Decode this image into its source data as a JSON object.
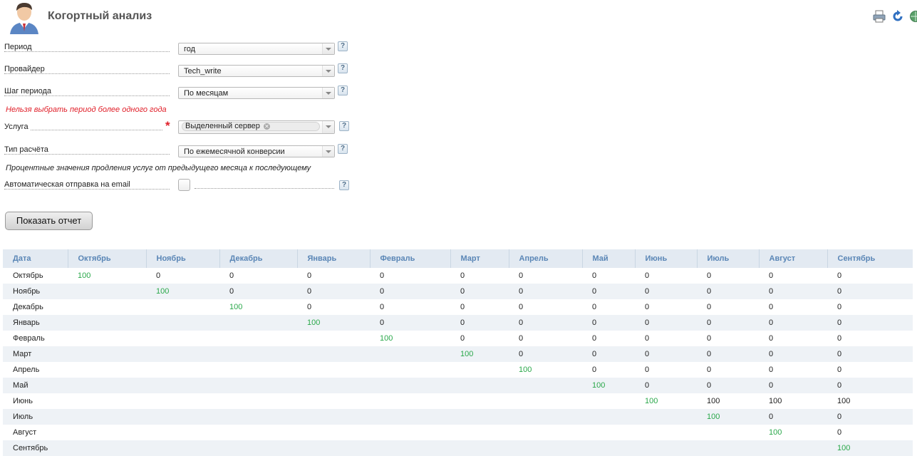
{
  "header": {
    "title": "Когортный анализ",
    "icons": [
      "user-avatar-icon",
      "print-icon",
      "refresh-icon",
      "globe-icon"
    ]
  },
  "form": {
    "period": {
      "label": "Период",
      "value": "год"
    },
    "provider": {
      "label": "Провайдер",
      "value": "Tech_write"
    },
    "step": {
      "label": "Шаг периода",
      "value": "По месяцам"
    },
    "step_error": "Нельзя выбрать период более одного года",
    "service": {
      "label": "Услуга",
      "tag": "Выделенный сервер"
    },
    "calc_type": {
      "label": "Тип расчёта",
      "value": "По ежемесячной конверсии"
    },
    "calc_hint": "Процентные значения продления услуг от предыдущего месяца к последующему",
    "auto_email": {
      "label": "Автоматическая отправка на email",
      "checked": false
    },
    "help_symbol": "?",
    "required_symbol": "*",
    "submit_label": "Показать отчет"
  },
  "colors": {
    "accent": "#5a86b6",
    "highlight": "#2aa84a",
    "error": "#e0202a",
    "header_bg": "#e3eaf2",
    "row_alt": "#eef2f6"
  },
  "table": {
    "columns": [
      "Дата",
      "Октябрь",
      "Ноябрь",
      "Декабрь",
      "Январь",
      "Февраль",
      "Март",
      "Апрель",
      "Май",
      "Июнь",
      "Июль",
      "Август",
      "Сентябрь"
    ],
    "rows": [
      [
        "Октябрь",
        "100",
        "0",
        "0",
        "0",
        "0",
        "0",
        "0",
        "0",
        "0",
        "0",
        "0",
        "0"
      ],
      [
        "Ноябрь",
        "",
        "100",
        "0",
        "0",
        "0",
        "0",
        "0",
        "0",
        "0",
        "0",
        "0",
        "0"
      ],
      [
        "Декабрь",
        "",
        "",
        "100",
        "0",
        "0",
        "0",
        "0",
        "0",
        "0",
        "0",
        "0",
        "0"
      ],
      [
        "Январь",
        "",
        "",
        "",
        "100",
        "0",
        "0",
        "0",
        "0",
        "0",
        "0",
        "0",
        "0"
      ],
      [
        "Февраль",
        "",
        "",
        "",
        "",
        "100",
        "0",
        "0",
        "0",
        "0",
        "0",
        "0",
        "0"
      ],
      [
        "Март",
        "",
        "",
        "",
        "",
        "",
        "100",
        "0",
        "0",
        "0",
        "0",
        "0",
        "0"
      ],
      [
        "Апрель",
        "",
        "",
        "",
        "",
        "",
        "",
        "100",
        "0",
        "0",
        "0",
        "0",
        "0"
      ],
      [
        "Май",
        "",
        "",
        "",
        "",
        "",
        "",
        "",
        "100",
        "0",
        "0",
        "0",
        "0"
      ],
      [
        "Июнь",
        "",
        "",
        "",
        "",
        "",
        "",
        "",
        "",
        "100",
        "100",
        "100",
        "100"
      ],
      [
        "Июль",
        "",
        "",
        "",
        "",
        "",
        "",
        "",
        "",
        "",
        "100",
        "0",
        "0"
      ],
      [
        "Август",
        "",
        "",
        "",
        "",
        "",
        "",
        "",
        "",
        "",
        "",
        "100",
        "0"
      ],
      [
        "Сентябрь",
        "",
        "",
        "",
        "",
        "",
        "",
        "",
        "",
        "",
        "",
        "",
        "100"
      ]
    ]
  }
}
